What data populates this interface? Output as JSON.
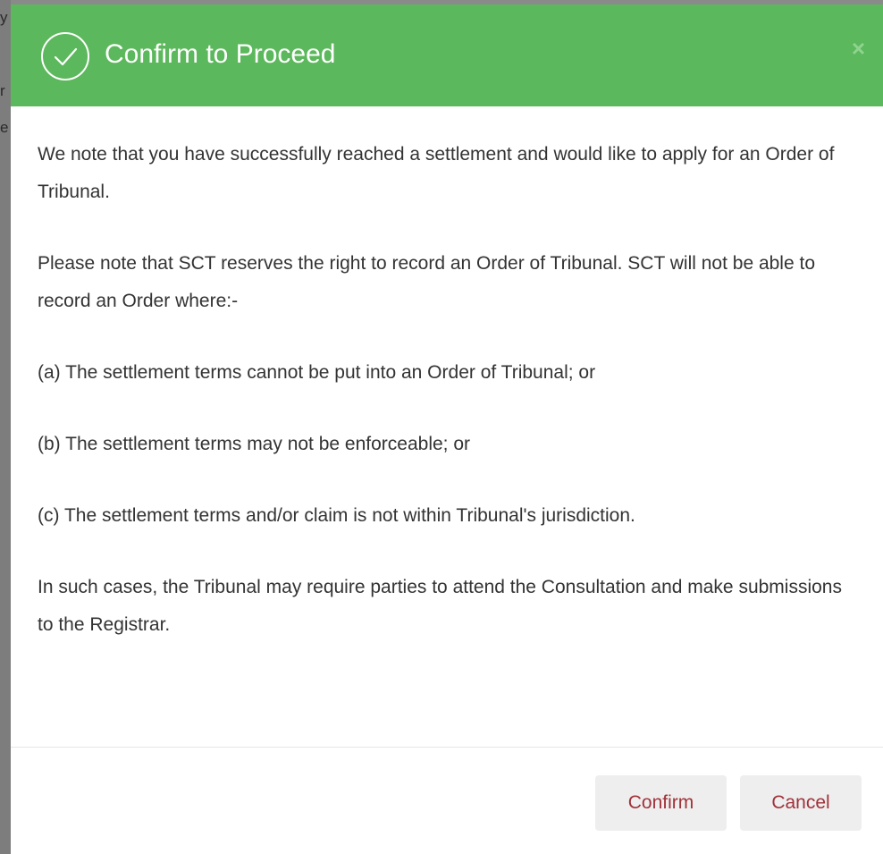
{
  "background": {
    "glyphs": [
      "y",
      "r",
      "e"
    ]
  },
  "dialog": {
    "title": "Confirm to Proceed",
    "close_label": "×",
    "header_color": "#5cb85c",
    "paragraphs": [
      "We note that you have successfully reached a settlement and would like to apply for an Order of Tribunal.",
      "Please note that SCT reserves the right to record an Order of Tribunal. SCT will not be able to record an Order where:-",
      "(a) The settlement terms cannot be put into an Order of Tribunal; or",
      "(b) The settlement terms may not be enforceable; or",
      "(c) The settlement terms and/or claim is not within Tribunal's jurisdiction.",
      "In such cases, the Tribunal may require parties to attend the Consultation and make submissions to the Registrar."
    ],
    "buttons": {
      "confirm_label": "Confirm",
      "cancel_label": "Cancel"
    },
    "icons": {
      "header_icon": "check-circle-icon",
      "close_icon": "close-icon"
    }
  }
}
